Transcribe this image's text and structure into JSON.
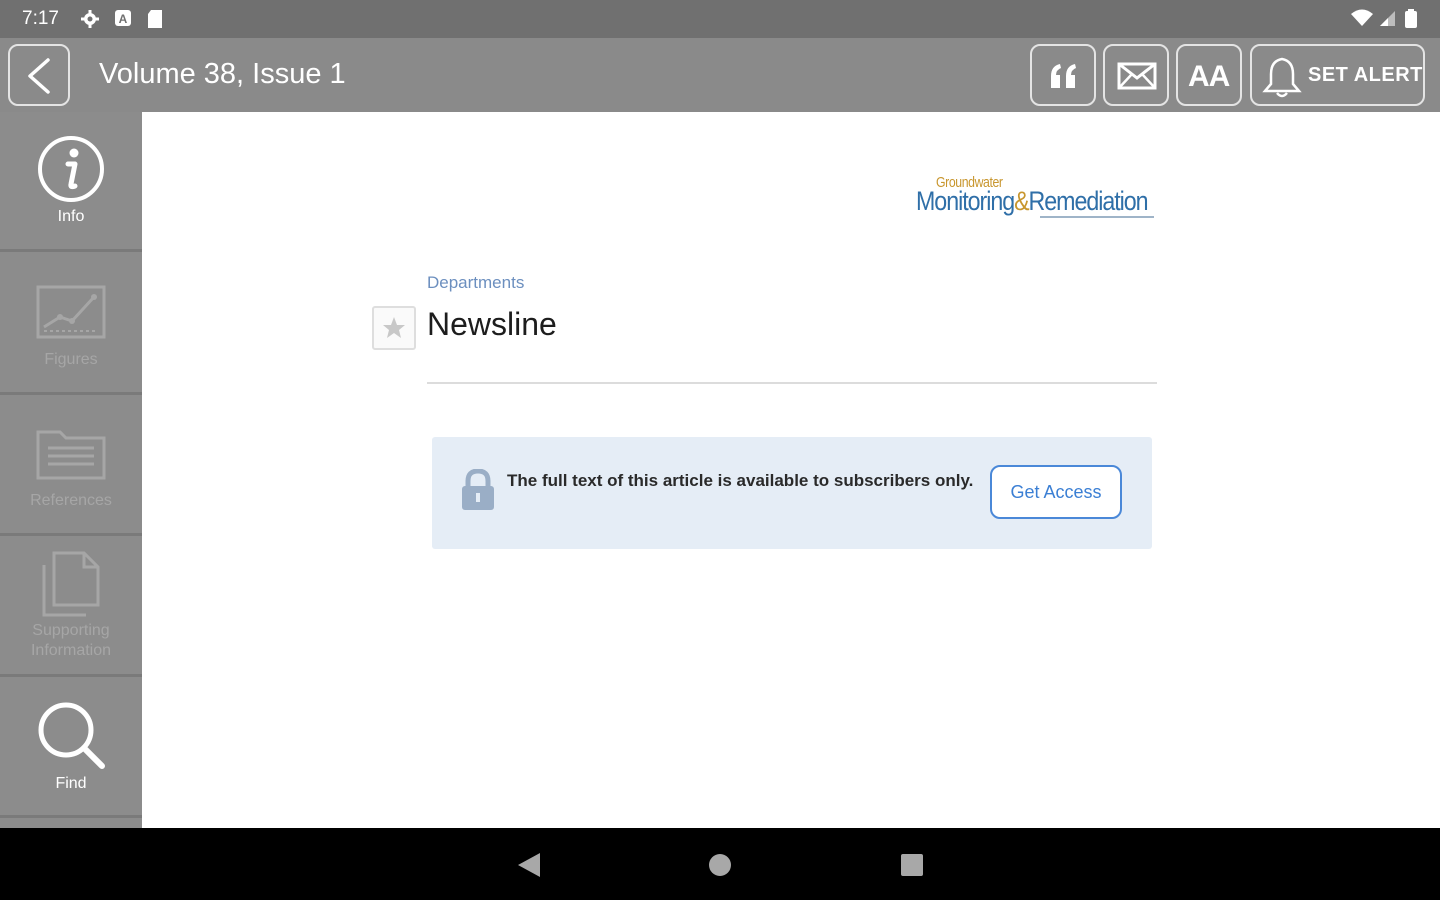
{
  "status_bar": {
    "time": "7:17",
    "icons": [
      "settings-icon",
      "notification-icon",
      "sd-card-icon",
      "wifi-icon",
      "signal-icon",
      "battery-icon"
    ]
  },
  "toolbar": {
    "title": "Volume 38, Issue 1",
    "cite_icon": "quote-icon",
    "email_icon": "mail-icon",
    "font_size_label": "AA",
    "alert_label": "SET ALERT"
  },
  "sidebar": {
    "items": [
      {
        "label": "Info",
        "icon": "info-icon",
        "enabled": true
      },
      {
        "label": "Figures",
        "icon": "chart-icon",
        "enabled": false
      },
      {
        "label": "References",
        "icon": "folder-icon",
        "enabled": false
      },
      {
        "label": "Supporting Information",
        "icon": "documents-icon",
        "enabled": false
      },
      {
        "label": "Find",
        "icon": "search-icon",
        "enabled": true
      }
    ]
  },
  "article": {
    "journal_logo_top": "Groundwater",
    "journal_logo_main_1": "Monitoring",
    "journal_logo_amp": "&",
    "journal_logo_main_2": "Remediation",
    "category": "Departments",
    "title": "Newsline",
    "access_message": "The full text of this article is available to subscribers only.",
    "access_button": "Get Access"
  },
  "colors": {
    "toolbar": "#8a8a8a",
    "sidebar": "#8c8c8c",
    "accent": "#3b7fd4",
    "access_box": "#e5edf6"
  }
}
